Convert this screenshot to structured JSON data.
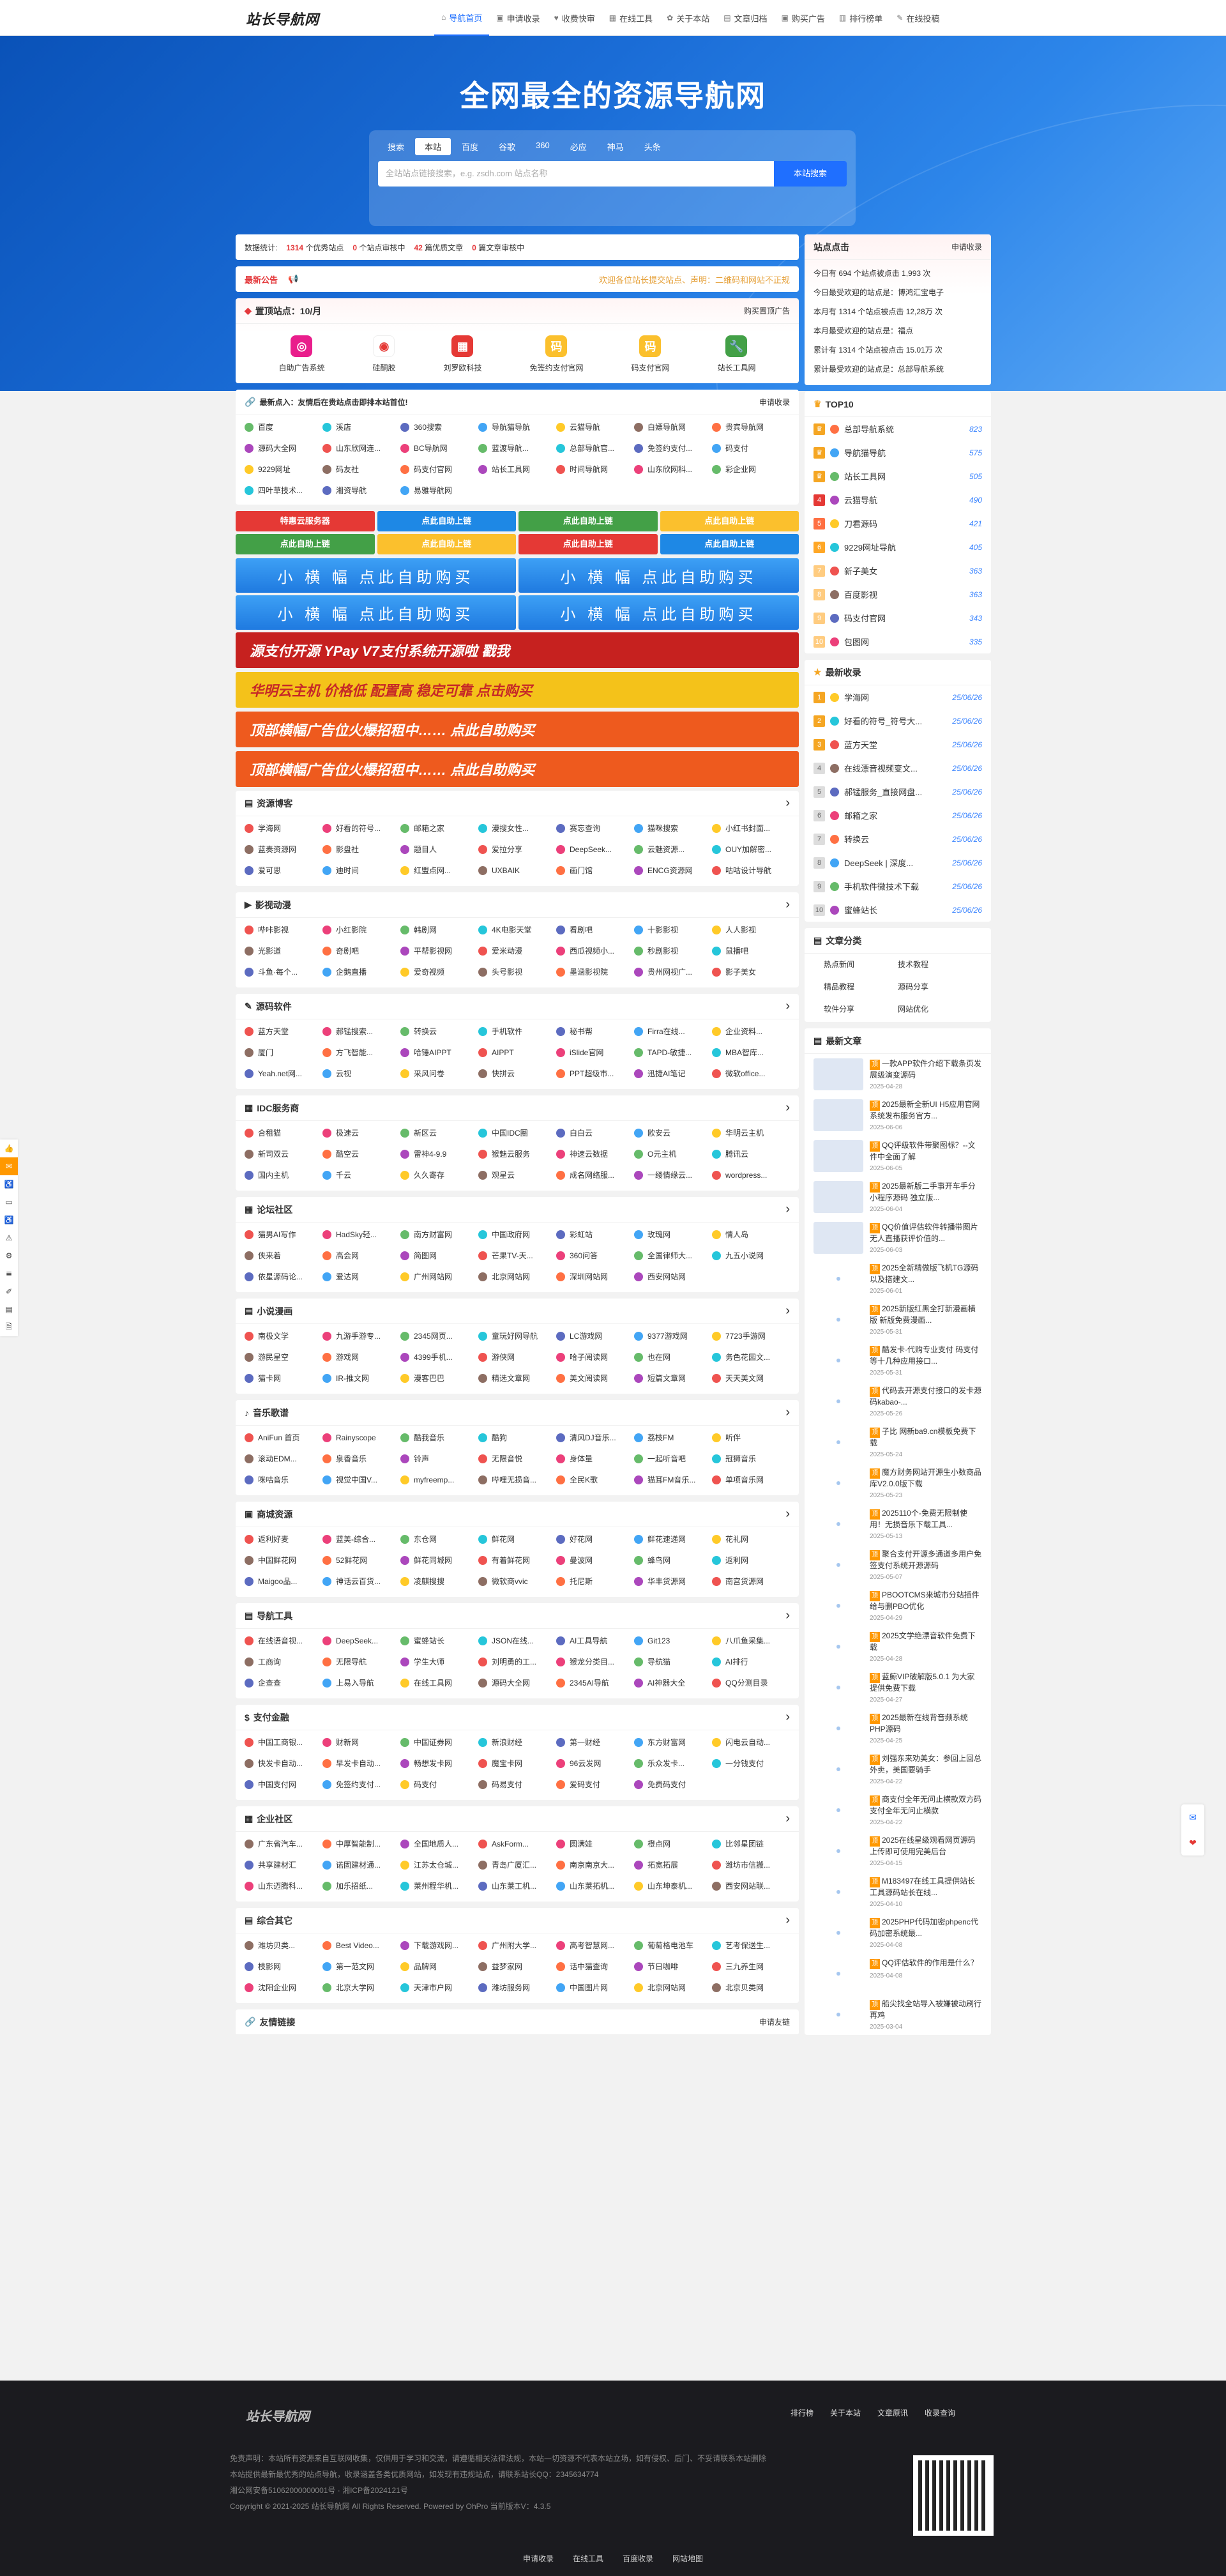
{
  "site": {
    "logo": "站长导航网"
  },
  "nav": [
    {
      "label": "导航首页",
      "icon": "⌂",
      "active": true
    },
    {
      "label": "申请收录",
      "icon": "▣"
    },
    {
      "label": "收费快审",
      "icon": "♥"
    },
    {
      "label": "在线工具",
      "icon": "▦"
    },
    {
      "label": "关于本站",
      "icon": "✿"
    },
    {
      "label": "文章归档",
      "icon": "▤"
    },
    {
      "label": "购买广告",
      "icon": "▣"
    },
    {
      "label": "排行榜单",
      "icon": "▥"
    },
    {
      "label": "在线投稿",
      "icon": "✎"
    }
  ],
  "hero": {
    "title": "全网最全的资源导航网",
    "tabs": [
      "搜索",
      "本站",
      "百度",
      "谷歌",
      "360",
      "必应",
      "神马",
      "头条"
    ],
    "placeholder": "全站站点链接搜索，e.g. zsdh.com 站点名称",
    "button": "本站搜索"
  },
  "stats": {
    "label": "数据统计:",
    "sites": "1314",
    "sites_u": "个优秀站点",
    "pending": "0",
    "pending_u": "个站点审核中",
    "articles": "42",
    "articles_u": "篇优质文章",
    "art_pending": "0",
    "art_pending_u": "篇文章审核中"
  },
  "notice": {
    "tag": "最新公告",
    "icon": "📢",
    "text": "欢迎各位站长提交站点、声明：二维码和网站不正规"
  },
  "recommend": {
    "title": "置顶站点：10/月",
    "right": "购买置顶广告",
    "items": [
      {
        "label": "自助广告系统",
        "color": "#e91e8c",
        "glyph": "◎"
      },
      {
        "label": "硅酮胶",
        "color": "#fff",
        "glyph": "◉"
      },
      {
        "label": "刘罗欧科技",
        "color": "#e53935",
        "glyph": "▦"
      },
      {
        "label": "免签约支付官网",
        "color": "#fbc02d",
        "glyph": "码"
      },
      {
        "label": "码支付官网",
        "color": "#fbc02d",
        "glyph": "码"
      },
      {
        "label": "站长工具网",
        "color": "#43a047",
        "glyph": "🔧"
      }
    ]
  },
  "latest": {
    "title": "最新点入：友情后在贵站点击即排本站首位!",
    "right": "申请收录",
    "items": [
      "百度",
      "溪店",
      "360搜索",
      "导航猫导航",
      "云猫导航",
      "白嫖导航网",
      "贵宾导航网",
      "源码大全网",
      "山东欣网连...",
      "BC导航网",
      "蓝渡导航...",
      "总部导航官...",
      "免签约支付...",
      "码支付",
      "9229网址",
      "码友社",
      "码支付官网",
      "站长工具网",
      "时间导航网",
      "山东欣网科...",
      "彩企业网",
      "四叶草技术...",
      "湘资导航",
      "易雅导航网"
    ]
  },
  "ads_small": [
    "特惠云服务器",
    "点此自助上链",
    "点此自助上链",
    "点此自助上链",
    "点此自助上链",
    "点此自助上链",
    "点此自助上链",
    "点此自助上链"
  ],
  "ads_wide": [
    "小 横 幅  点此自助购买",
    "小 横 幅  点此自助购买",
    "小 横 幅  点此自助购买",
    "小 横 幅  点此自助购买"
  ],
  "banners": [
    {
      "text": "源支付开源     YPay V7支付系统开源啦  戳我",
      "bg": "#c6211f"
    },
    {
      "text": "华明云主机  价格低  配置高  稳定可靠   点击购买",
      "bg": "#f4c21a"
    },
    {
      "text": "顶部横幅广告位火爆招租中……    点此自助购买",
      "bg": "#ee5a1e"
    },
    {
      "text": "顶部横幅广告位火爆招租中……    点此自助购买",
      "bg": "#ee5a1e"
    }
  ],
  "sections": [
    {
      "title": "资源博客",
      "items": [
        "学海网",
        "好看的符号...",
        "邮箱之家",
        "漫搜女性...",
        "赛忘查询",
        "猫咪搜索",
        "小红书封面...",
        "蓝奏资源网",
        "影盘社",
        "题目人",
        "爱拉分享",
        "DeepSeek...",
        "云魅资源...",
        "OUY加解密...",
        "爱可思",
        "迪时间",
        "红盟点网...",
        "UXBAIK",
        "画门馆",
        "ENCG资源网",
        "咕咕设计导航"
      ]
    },
    {
      "title": "影视动漫",
      "items": [
        "哔咔影视",
        "小红影院",
        "韩剧网",
        "4K电影天堂",
        "看剧吧",
        "十影影视",
        "人人影视",
        "光影道",
        "奇剧吧",
        "平帮影视网",
        "爱米动漫",
        "西瓜视频小...",
        "秒剧影视",
        "鼠播吧",
        "斗鱼·每个...",
        "企鹅直播",
        "爱奇视频",
        "头号影视",
        "墨涵影视院",
        "贵州网视广...",
        "影子美女"
      ]
    },
    {
      "title": "源码软件",
      "items": [
        "蓝方天堂",
        "郝锰搜索...",
        "转换云",
        "手机软件",
        "秘书帮",
        "Firra在线...",
        "企业资料...",
        "厦门",
        "方飞智能...",
        "哈锤AIPPT",
        "AIPPT",
        "iSlide官网",
        "TAPD-敏捷...",
        "MBA智库...",
        "Yeah.net网...",
        "云视",
        "采风问卷",
        "快拼云",
        "PPT超级市...",
        "迅捷AI笔记",
        "微软office..."
      ]
    },
    {
      "title": "IDC服务商",
      "items": [
        "合租猫",
        "极速云",
        "新区云",
        "中国IDC圈",
        "白白云",
        "欧安云",
        "华明云主机",
        "新司双云",
        "酷空云",
        "雷神4-9.9",
        "猴魅云服务",
        "神速云数据",
        "O元主机",
        "腾讯云",
        "国内主机",
        "千云",
        "久久寄存",
        "观星云",
        "成名网络服...",
        "一缕情缘云...",
        "wordpress..."
      ]
    },
    {
      "title": "论坛社区",
      "items": [
        "猫男AI写作",
        "HadSky轻...",
        "南方财富网",
        "中国政府网",
        "彩虹站",
        "玫瑰网",
        "情人岛",
        "侠来着",
        "高会网",
        "简图网",
        "芒果TV-天...",
        "360问答",
        "全国律师大...",
        "九五小说网",
        "依星源码论...",
        "爱达网",
        "广州网站网",
        "北京网站网",
        "深圳网站网",
        "西安网站网",
        ""
      ]
    },
    {
      "title": "小说漫画",
      "items": [
        "南极文学",
        "九游手游专...",
        "2345网页...",
        "童玩好网导航",
        "LC游戏网",
        "9377游戏网",
        "7723手游网",
        "游民星空",
        "游戏网",
        "4399手机...",
        "游侠网",
        "哈子阅读网",
        "也在网",
        "务色花园文...",
        "猫卡网",
        "IR-推文网",
        "漫客巴巴",
        "精选文章网",
        "美文阅读网",
        "短篇文章网",
        "天天美文网"
      ]
    },
    {
      "title": "音乐歌谱",
      "items": [
        "AniFun 首页",
        "Rainyscope",
        "酷我音乐",
        "酷狗",
        "清风DJ音乐...",
        "荔枝FM",
        "听伴",
        "滚动EDM...",
        "泉香音乐",
        "铃声",
        "无限音悦",
        "身体量",
        "一起听音吧",
        "冠狮音乐",
        "咪咕音乐",
        "视觉中国V...",
        "myfreemp...",
        "哔哩无损音...",
        "全民K歌",
        "猫耳FM音乐...",
        "单项音乐网"
      ]
    },
    {
      "title": "商城资源",
      "items": [
        "返利好麦",
        "蓝美-综合...",
        "东仓网",
        "鲜花网",
        "好花网",
        "鲜花速递网",
        "花礼网",
        "中国鲜花网",
        "52鲜花网",
        "鲜花同城网",
        "有着鲜花网",
        "曼波网",
        "蜂鸟网",
        "返利网",
        "Maigoo品...",
        "神话云百货...",
        "凌麒搜搜",
        "微软商vvic",
        "托尼斯",
        "华丰货源网",
        "南宫货源网"
      ]
    },
    {
      "title": "导航工具",
      "items": [
        "在线语音视...",
        "DeepSeek...",
        "蜜蜂站长",
        "JSON在线...",
        "AI工具导航",
        "Git123",
        "八爪鱼采集...",
        "工商询",
        "无限导航",
        "学生大师",
        "刘明勇的工...",
        "猴龙分类目...",
        "导航猫",
        "AI排行",
        "企查查",
        "上易入导航",
        "在线工具网",
        "源码大全网",
        "2345AI导航",
        "AI神器大全",
        "QQ分测目录"
      ]
    },
    {
      "title": "支付金融",
      "items": [
        "中国工商银...",
        "财新网",
        "中国证券网",
        "新浪财经",
        "第一财经",
        "东方财富网",
        "闪电云自动...",
        "快发卡自动...",
        "早发卡自动...",
        "畅想发卡网",
        "魔宝卡网",
        "96云发网",
        "乐众发卡...",
        "一分钱支付",
        "中国支付网",
        "免签约支付...",
        "码支付",
        "码易支付",
        "爱码支付",
        "免费码支付",
        ""
      ]
    },
    {
      "title": "企业社区",
      "items": [
        "广东省汽车...",
        "中厚智能制...",
        "全国地质人...",
        "AskForm...",
        "圆满娃",
        "橙点网",
        "比邻星团链",
        "共享建材汇",
        "诺固建材通...",
        "江苏太仓城...",
        "青岛广厦汇...",
        "南京南京大...",
        "拓宽拓展",
        "潍坊市信搬...",
        "山东迈腾科...",
        "加乐招纸...",
        "莱州程华机...",
        "山东莱工机...",
        "山东莱拓机...",
        "山东坤泰机...",
        "西安网站联..."
      ]
    },
    {
      "title": "综合其它",
      "items": [
        "潍坊贝类...",
        "Best Video...",
        "下载游戏网...",
        "广州附大学...",
        "高考智慧网...",
        "葡萄格电池车",
        "艺考保送生...",
        "枝影网",
        "第一范文网",
        "品牌网",
        "益梦家网",
        "话中猫查询",
        "节日咖啡",
        "三九养生网",
        "沈阳企业网",
        "北京大学网",
        "天津市户网",
        "潍坊服务网",
        "中国图片网",
        "北京网站网",
        "北京贝类网"
      ]
    }
  ],
  "friends": {
    "title": "友情链接",
    "right": "申请友链"
  },
  "side": {
    "clicks": {
      "title": "站点点击",
      "right": "申请收录",
      "lines": [
        "今日有 694 个站点被点击 1,993 次",
        "今日最受欢迎的站点是：博鸿汇宝电子",
        "本月有 1314 个站点被点击 12,28万 次",
        "本月最受欢迎的站点是：福点",
        "累计有 1314 个站点被点击 15.01万 次",
        "累计最受欢迎的站点是：总部导航系统"
      ]
    },
    "top10": {
      "title": "TOP10",
      "rows": [
        {
          "name": "总部导航系统",
          "n": "823"
        },
        {
          "name": "导航猫导航",
          "n": "575"
        },
        {
          "name": "站长工具网",
          "n": "505"
        },
        {
          "name": "云猫导航",
          "n": "490"
        },
        {
          "name": "刀看源码",
          "n": "421"
        },
        {
          "name": "9229网址导航",
          "n": "405"
        },
        {
          "name": "新子美女",
          "n": "363"
        },
        {
          "name": "百度影视",
          "n": "363"
        },
        {
          "name": "码支付官网",
          "n": "343"
        },
        {
          "name": "包图网",
          "n": "335"
        }
      ]
    },
    "newest": {
      "title": "最新收录",
      "rows": [
        {
          "name": "学海网",
          "d": "25/06/26"
        },
        {
          "name": "好看的符号_符号大...",
          "d": "25/06/26"
        },
        {
          "name": "蓝方天堂",
          "d": "25/06/26"
        },
        {
          "name": "在线漂音视频变文...",
          "d": "25/06/26"
        },
        {
          "name": "郝锰服务_直接网盘...",
          "d": "25/06/26"
        },
        {
          "name": "邮箱之家",
          "d": "25/06/26"
        },
        {
          "name": "转换云",
          "d": "25/06/26"
        },
        {
          "name": "DeepSeek | 深度...",
          "d": "25/06/26"
        },
        {
          "name": "手机软件微技术下载",
          "d": "25/06/26"
        },
        {
          "name": "蜜蜂站长",
          "d": "25/06/26"
        }
      ]
    },
    "cats": {
      "title": "文章分类",
      "items": [
        "热点新闻",
        "技术教程",
        "精品教程",
        "源码分享",
        "软件分享",
        "网站优化"
      ]
    },
    "articles": {
      "title": "最新文章",
      "items": [
        {
          "t": "一款APP软件介绍下载条页发展级演变源码",
          "m": "2025-04-28",
          "thumb": true
        },
        {
          "t": "2025最新全新UI H5应用官网系统发布服务官方...",
          "m": "2025-06-06",
          "thumb": true
        },
        {
          "t": "QQ评级软件带聚图标？--文件中全面了解",
          "m": "2025-06-05",
          "thumb": true
        },
        {
          "t": "2025最新版二手事开车手分小程序源码 独立版...",
          "m": "2025-06-04",
          "thumb": true
        },
        {
          "t": "QQ价值评估软件转播带图片无人直播获评价值的...",
          "m": "2025-06-03",
          "thumb": true
        },
        {
          "t": "2025全新精做版飞机TG源码以及搭建文...",
          "m": "2025-06-01",
          "thumb": false
        },
        {
          "t": "2025新版红黑全打新漫画横版 新版免费漫画...",
          "m": "2025-05-31",
          "thumb": false
        },
        {
          "t": "酷发卡·代购专业支付 码支付等十几种应用接口...",
          "m": "2025-05-31",
          "thumb": false
        },
        {
          "t": "代码去开源支付接口的发卡源码kabao-...",
          "m": "2025-05-26",
          "thumb": false
        },
        {
          "t": "子比 网新ba9.cn模板免费下载",
          "m": "2025-05-24",
          "thumb": false
        },
        {
          "t": "魔方财务网站开源生小数商品库V2.0.0版下载",
          "m": "2025-05-23",
          "thumb": false
        },
        {
          "t": "2025110个-免费无限制使用！无损音乐下载工具...",
          "m": "2025-05-13",
          "thumb": false
        },
        {
          "t": "聚合支付开源多通道多用户免签支付系统开源源码",
          "m": "2025-05-07",
          "thumb": false
        },
        {
          "t": "PBOOTCMS来城市分站插件给与删PBO优化",
          "m": "2025-04-29",
          "thumb": false
        },
        {
          "t": "2025文学绝漂音软件免费下载",
          "m": "2025-04-28",
          "thumb": false
        },
        {
          "t": "蓝鲸VIP破解版5.0.1 为大家提供免费下载",
          "m": "2025-04-27",
          "thumb": false
        },
        {
          "t": "2025最新在线背音频系统PHP源码",
          "m": "2025-04-25",
          "thumb": false
        },
        {
          "t": "刘强东来劝美女：参回上回总外卖，美国要骑手",
          "m": "2025-04-22",
          "thumb": false
        },
        {
          "t": "商支付全年无问止横款双方码支付全年无问止横款",
          "m": "2025-04-22",
          "thumb": false
        },
        {
          "t": "2025在线星级观看网页源码上传即可使用完美后台",
          "m": "2025-04-15",
          "thumb": false
        },
        {
          "t": "M183497在线工具提供站长工具源码站长在线...",
          "m": "2025-04-10",
          "thumb": false
        },
        {
          "t": "2025PHP代码加密phpenc代码加密系统最...",
          "m": "2025-04-08",
          "thumb": false
        },
        {
          "t": "QQ评估软件的作用是什么？",
          "m": "2025-04-08",
          "thumb": false
        },
        {
          "t": "船尖找全站导入被嫌被动刷行再鸡",
          "m": "2025-03-04",
          "thumb": false
        }
      ]
    }
  },
  "footer": {
    "logo": "站长导航网",
    "links": [
      "排行榜",
      "关于本站",
      "文章原讯",
      "收录查询"
    ],
    "lines": [
      "免责声明：本站所有资源来自互联网收集，仅供用于学习和交流，请遵循相关法律法规，本站一切资源不代表本站立场，如有侵权、后门、不妥请联系本站删除",
      "本站提供最新最优秀的站点导航，收录涵盖各类优质网站，如发现有违规站点，请联系站长QQ：2345634774",
      "湘公网安备51062000000001号  ·  湘ICP备2024121号",
      "Copyright © 2021-2025 站长导航网 All Rights Reserved. Powered by OhPro 当前版本V：4.3.5"
    ],
    "bottom": [
      "申请收录",
      "在线工具",
      "百度收录",
      "网站地图"
    ]
  },
  "lefttool": [
    "👍",
    "✉",
    "♿",
    "▭",
    "♿",
    "⚠",
    "⚙",
    "≣",
    "✐",
    "▤",
    "🗎"
  ],
  "righttool": [
    "✉",
    "❤"
  ]
}
